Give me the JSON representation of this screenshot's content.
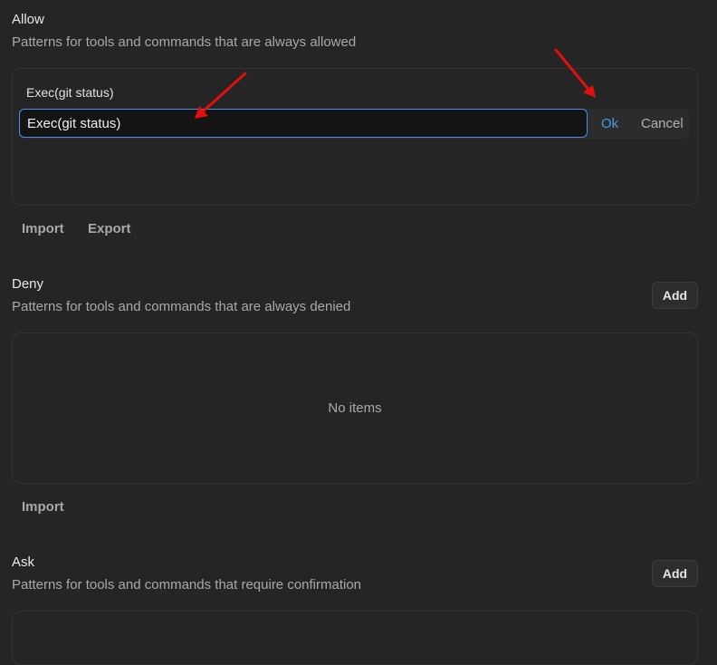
{
  "allow": {
    "title": "Allow",
    "description": "Patterns for tools and commands that are always allowed",
    "item_label": "Exec(git status)",
    "edit_value": "Exec(git status)",
    "ok_label": "Ok",
    "cancel_label": "Cancel",
    "import_label": "Import",
    "export_label": "Export"
  },
  "deny": {
    "title": "Deny",
    "description": "Patterns for tools and commands that are always denied",
    "add_label": "Add",
    "empty_text": "No items",
    "import_label": "Import"
  },
  "ask": {
    "title": "Ask",
    "description": "Patterns for tools and commands that require confirmation",
    "add_label": "Add"
  },
  "colors": {
    "background": "#252525",
    "accent": "#4a98e0",
    "annotation": "#e01010"
  },
  "annotations": [
    "red-arrow",
    "red-arrow"
  ]
}
